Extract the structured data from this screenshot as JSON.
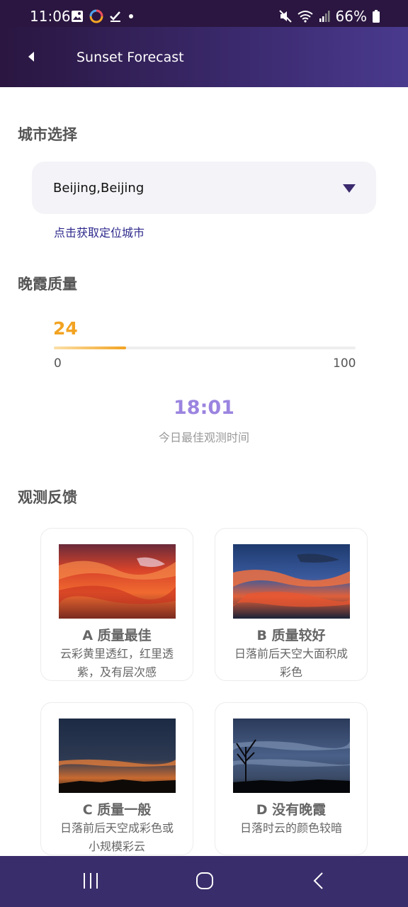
{
  "status_bar": {
    "time": "11:06",
    "battery": "66%"
  },
  "app_bar": {
    "title": "Sunset Forecast"
  },
  "city_section": {
    "title": "城市选择",
    "selected_city": "Beijing,Beijing",
    "locate_link": "点击获取定位城市"
  },
  "quality_section": {
    "title": "晚霞质量",
    "value": "24",
    "range_min": "0",
    "range_max": "100",
    "progress_fraction": 0.24,
    "best_time": "18:01",
    "best_time_label": "今日最佳观测时间"
  },
  "feedback_section": {
    "title": "观测反馈",
    "cards": [
      {
        "title": "A 质量最佳",
        "desc": "云彩黄里透红，红里透紫，及有层次感"
      },
      {
        "title": "B 质量较好",
        "desc": "日落前后天空大面积成彩色"
      },
      {
        "title": "C 质量一般",
        "desc": "日落前后天空成彩色或小规模彩云"
      },
      {
        "title": "D 没有晚霞",
        "desc": "日落时云的颜色较暗"
      }
    ]
  },
  "colors": {
    "accent_orange": "#f2a321",
    "accent_purple": "#9b84e0",
    "link_blue": "#2e2a8c",
    "header_dark": "#2a1640",
    "nav_bar": "#3a2d6b"
  }
}
